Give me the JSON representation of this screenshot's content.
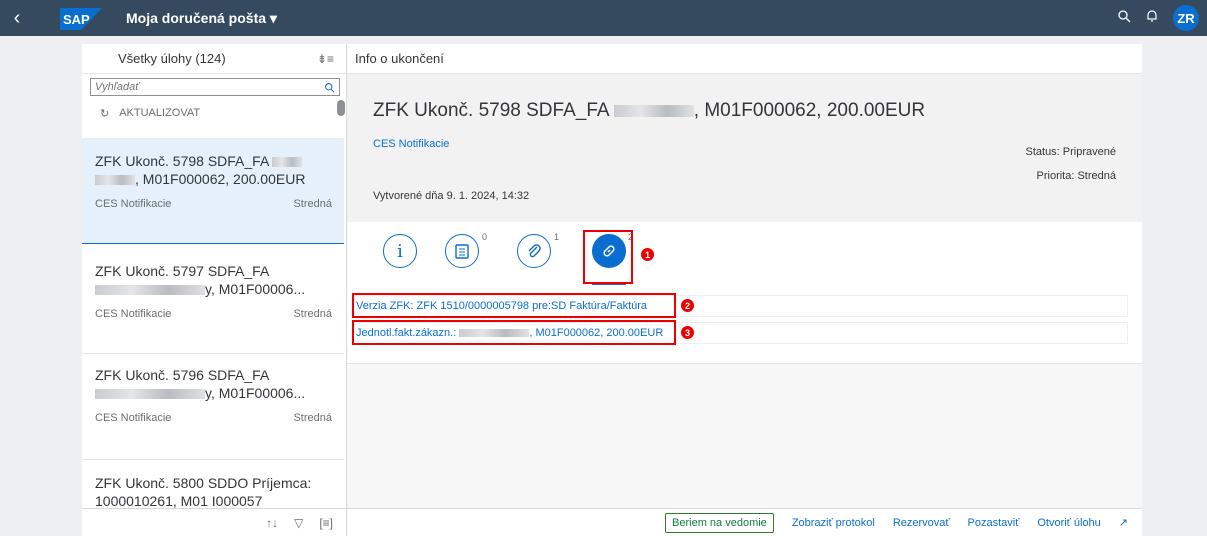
{
  "shell": {
    "title": "Moja doručená pošta ▾",
    "logo": "SAP",
    "avatar": "ZR",
    "icons": [
      "back-icon",
      "search-icon",
      "bell-icon"
    ]
  },
  "master": {
    "header": "Všetky úlohy (124)",
    "search_placeholder": "Vyhľadať",
    "refresh": "AKTUALIZOVAT",
    "items": [
      {
        "title_a": "ZFK Ukonč. 5798 SDFA_FA",
        "title_b": ", M01F000062, 200.00EUR",
        "source": "CES Notifikacie",
        "priority": "Stredná"
      },
      {
        "title_a": "ZFK Ukonč. 5797 SDFA_FA",
        "title_b": "y, M01F00006...",
        "source": "CES Notifikacie",
        "priority": "Stredná"
      },
      {
        "title_a": "ZFK Ukonč. 5796 SDFA_FA",
        "title_b": "y, M01F00006...",
        "source": "CES Notifikacie",
        "priority": "Stredná"
      },
      {
        "title_a": "ZFK Ukonč. 5800 SDDO Príjemca:",
        "title_b": "1000010261, M01 I000057"
      }
    ]
  },
  "detail": {
    "header": "Info o ukončení",
    "title_a": "ZFK Ukonč. 5798 SDFA_FA",
    "title_b": ", M01F000062, 200.00EUR",
    "subtitle": "CES Notifikacie",
    "created": "Vytvorené dňa 9. 1. 2024, 14:32",
    "status": "Status: Pripravené",
    "priority": "Priorita: Stredná",
    "tabs": [
      {
        "icon": "info-icon",
        "count": ""
      },
      {
        "icon": "notes-icon",
        "count": "0"
      },
      {
        "icon": "paperclip-icon",
        "count": "1"
      },
      {
        "icon": "link-icon",
        "count": "2"
      }
    ],
    "related": [
      "Verzia ZFK: ZFK 1510/0000005798 pre:SD Faktúra/Faktúra",
      "Jednotl.fakt.zákazn.: , M01F000062, 200.00EUR"
    ],
    "badges": [
      "1",
      "2",
      "3"
    ]
  },
  "footer": {
    "acknowledge": "Beriem na vedomie",
    "show_log": "Zobraziť protokol",
    "reserve": "Rezervovať",
    "suspend": "Pozastaviť",
    "open_task": "Otvoriť úlohu"
  },
  "colors": {
    "shell": "#354a5f",
    "accent": "#0a6ed1",
    "annotation": "#ee0000"
  }
}
